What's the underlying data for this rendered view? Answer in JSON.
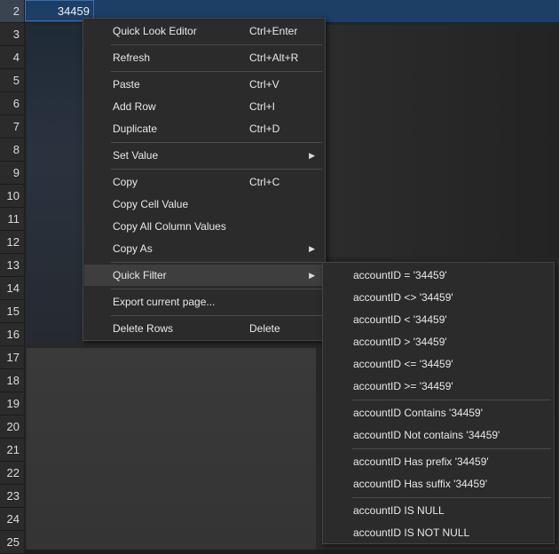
{
  "grid": {
    "selected_cell_value": "34459",
    "row_numbers": [
      "2",
      "3",
      "4",
      "5",
      "6",
      "7",
      "8",
      "9",
      "10",
      "11",
      "12",
      "13",
      "14",
      "15",
      "16",
      "17",
      "18",
      "19",
      "20",
      "21",
      "22",
      "23",
      "24",
      "25"
    ]
  },
  "context_menu": {
    "items": [
      {
        "label": "Quick Look Editor",
        "shortcut": "Ctrl+Enter"
      },
      {
        "label": "Refresh",
        "shortcut": "Ctrl+Alt+R"
      },
      {
        "label": "Paste",
        "shortcut": "Ctrl+V"
      },
      {
        "label": "Add Row",
        "shortcut": "Ctrl+I"
      },
      {
        "label": "Duplicate",
        "shortcut": "Ctrl+D"
      },
      {
        "label": "Set Value",
        "shortcut": ""
      },
      {
        "label": "Copy",
        "shortcut": "Ctrl+C"
      },
      {
        "label": "Copy Cell Value",
        "shortcut": ""
      },
      {
        "label": "Copy All Column Values",
        "shortcut": ""
      },
      {
        "label": "Copy As",
        "shortcut": ""
      },
      {
        "label": "Quick Filter",
        "shortcut": ""
      },
      {
        "label": "Export current page...",
        "shortcut": ""
      },
      {
        "label": "Delete Rows",
        "shortcut": "Delete"
      }
    ],
    "submenu_arrow_icon": "chevron-right-icon"
  },
  "quick_filter_submenu": {
    "items": [
      "accountID = '34459'",
      "accountID <> '34459'",
      "accountID < '34459'",
      "accountID > '34459'",
      "accountID <= '34459'",
      "accountID >= '34459'",
      "accountID Contains '34459'",
      "accountID Not contains '34459'",
      "accountID Has prefix '34459'",
      "accountID Has suffix '34459'",
      "accountID IS NULL",
      "accountID IS NOT NULL"
    ]
  },
  "colors": {
    "menu_bg": "#2b2b2b",
    "highlight": "#3e3e3e",
    "selection": "#1d3f66"
  }
}
